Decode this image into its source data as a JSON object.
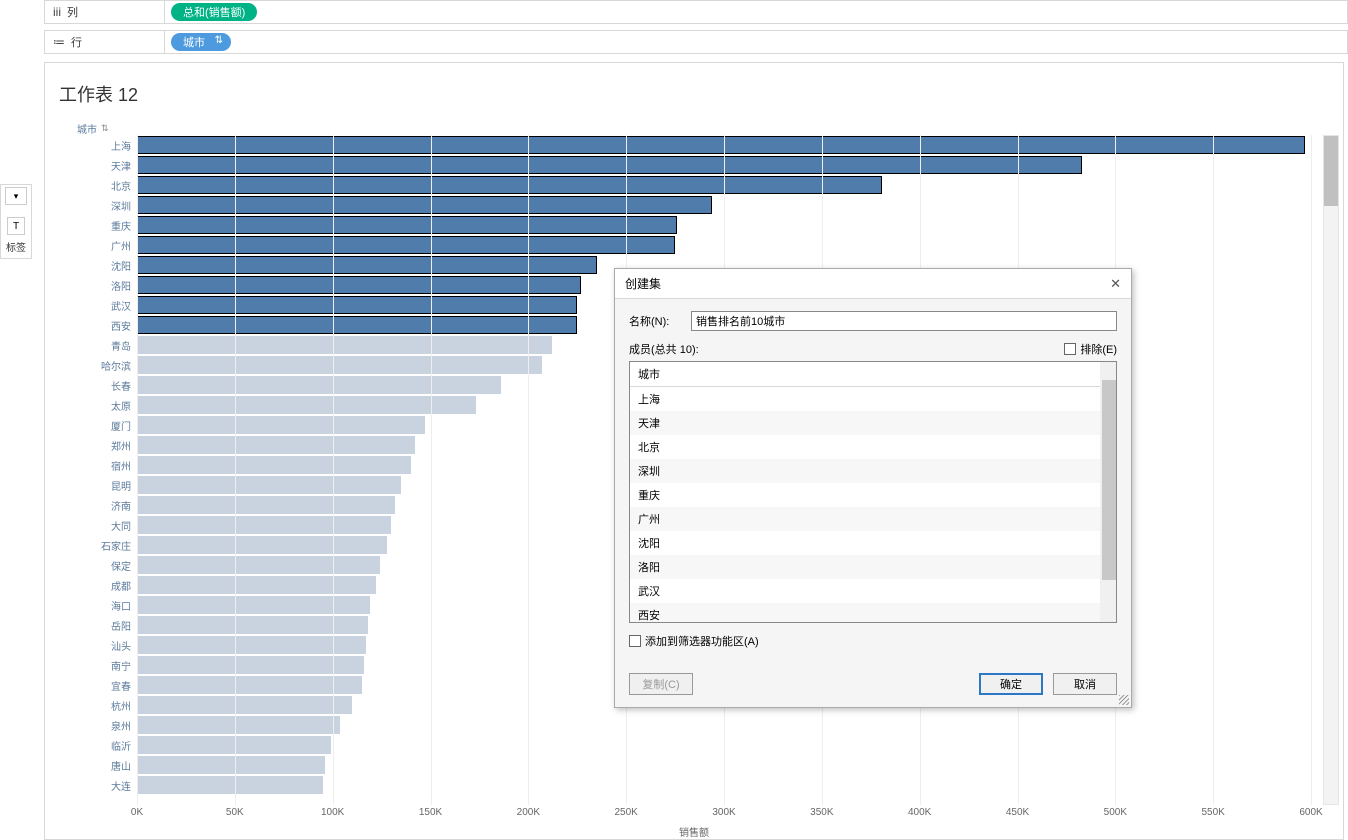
{
  "shelves": {
    "columns_label": "列",
    "columns_pill": "总和(销售额)",
    "rows_label": "行",
    "rows_pill": "城市"
  },
  "side_panel": {
    "dropdown_caret": "▾",
    "text_icon": "T",
    "label_text": "标签"
  },
  "sheet_title": "工作表 12",
  "axis_header": "城市",
  "x_axis_title": "销售额",
  "chart_data": {
    "type": "bar",
    "orientation": "horizontal",
    "xlabel": "销售额",
    "ylabel": "城市",
    "xlim": [
      0,
      600000
    ],
    "x_ticks": [
      0,
      50000,
      100000,
      150000,
      200000,
      250000,
      300000,
      350000,
      400000,
      450000,
      500000,
      550000,
      600000
    ],
    "x_tick_labels": [
      "0K",
      "50K",
      "100K",
      "150K",
      "200K",
      "250K",
      "300K",
      "350K",
      "400K",
      "450K",
      "500K",
      "550K",
      "600K"
    ],
    "categories": [
      "上海",
      "天津",
      "北京",
      "深圳",
      "重庆",
      "广州",
      "沈阳",
      "洛阳",
      "武汉",
      "西安",
      "青岛",
      "哈尔滨",
      "长春",
      "太原",
      "厦门",
      "郑州",
      "宿州",
      "昆明",
      "济南",
      "大同",
      "石家庄",
      "保定",
      "成都",
      "海口",
      "岳阳",
      "汕头",
      "南宁",
      "宜春",
      "杭州",
      "泉州",
      "临沂",
      "唐山",
      "大连"
    ],
    "values": [
      597000,
      483000,
      381000,
      294000,
      276000,
      275000,
      235000,
      227000,
      225000,
      225000,
      212000,
      207000,
      186000,
      173000,
      147000,
      142000,
      140000,
      135000,
      132000,
      130000,
      128000,
      124000,
      122000,
      119000,
      118000,
      117000,
      116000,
      115000,
      110000,
      104000,
      99000,
      96000,
      95000
    ],
    "highlighted_count": 10
  },
  "dialog": {
    "title": "创建集",
    "name_label": "名称(N):",
    "name_value": "销售排名前10城市",
    "members_label": "成员(总共 10):",
    "exclude_label": "排除(E)",
    "list_header": "城市",
    "members": [
      "上海",
      "天津",
      "北京",
      "深圳",
      "重庆",
      "广州",
      "沈阳",
      "洛阳",
      "武汉",
      "西安"
    ],
    "add_filter_label": "添加到筛选器功能区(A)",
    "copy_btn": "复制(C)",
    "ok_btn": "确定",
    "cancel_btn": "取消"
  }
}
